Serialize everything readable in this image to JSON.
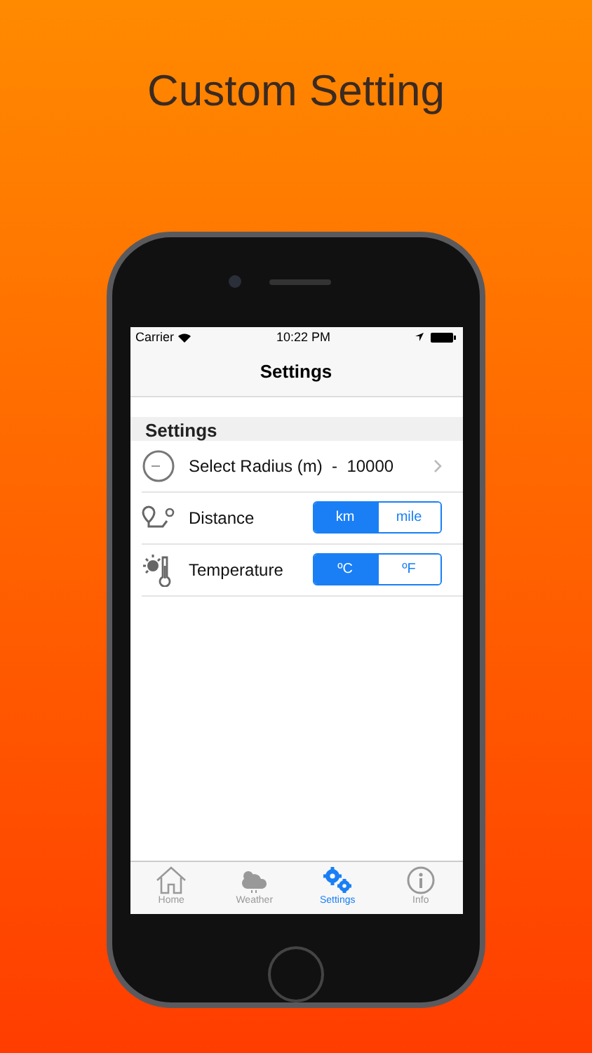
{
  "headline": "Custom Setting",
  "status_bar": {
    "carrier": "Carrier",
    "time": "10:22 PM"
  },
  "nav_bar": {
    "title": "Settings"
  },
  "section": {
    "header": "Settings",
    "rows": [
      {
        "kind": "disclosure",
        "label": "Select Radius (m)  -  10000"
      },
      {
        "kind": "segmented",
        "label": "Distance",
        "options": [
          {
            "label": "km",
            "selected": true
          },
          {
            "label": "mile",
            "selected": false
          }
        ]
      },
      {
        "kind": "segmented",
        "label": "Temperature",
        "options": [
          {
            "label": "ºC",
            "selected": true
          },
          {
            "label": "ºF",
            "selected": false
          }
        ]
      }
    ]
  },
  "tab_bar": [
    {
      "label": "Home",
      "selected": false
    },
    {
      "label": "Weather",
      "selected": false
    },
    {
      "label": "Settings",
      "selected": true
    },
    {
      "label": "Info",
      "selected": false
    }
  ]
}
